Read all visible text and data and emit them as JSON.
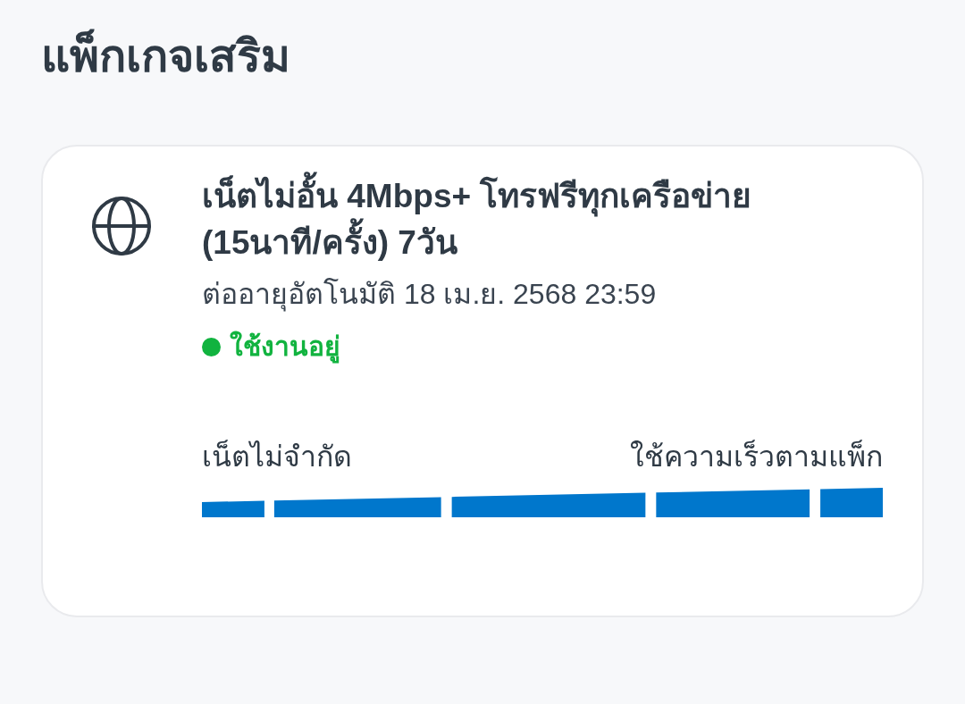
{
  "page": {
    "title": "แพ็กเกจเสริม"
  },
  "packages": [
    {
      "name": "เน็ตไม่อั้น 4Mbps+ โทรฟรีทุกเครือข่าย (15นาที/ครั้ง) 7วัน",
      "renewal": "ต่ออายุอัตโนมัติ 18 เม.ย. 2568 23:59",
      "status": {
        "label": "ใช้งานอยู่",
        "color": "#11b33f"
      },
      "speed": {
        "left_label": "เน็ตไม่จำกัด",
        "right_label": "ใช้ความเร็วตามแพ็ก"
      }
    }
  ]
}
